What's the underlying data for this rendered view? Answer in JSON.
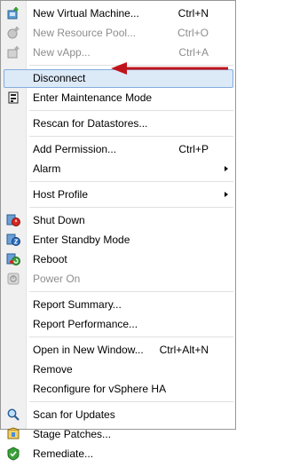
{
  "menu": {
    "new_vm": {
      "label": "New Virtual Machine...",
      "shortcut": "Ctrl+N"
    },
    "new_pool": {
      "label": "New Resource Pool...",
      "shortcut": "Ctrl+O"
    },
    "new_vapp": {
      "label": "New vApp...",
      "shortcut": "Ctrl+A"
    },
    "disconnect": {
      "label": "Disconnect"
    },
    "maintenance": {
      "label": "Enter Maintenance Mode"
    },
    "rescan": {
      "label": "Rescan for Datastores..."
    },
    "add_permission": {
      "label": "Add Permission...",
      "shortcut": "Ctrl+P"
    },
    "alarm": {
      "label": "Alarm"
    },
    "host_profile": {
      "label": "Host Profile"
    },
    "shut_down": {
      "label": "Shut Down"
    },
    "standby": {
      "label": "Enter Standby Mode"
    },
    "reboot": {
      "label": "Reboot"
    },
    "power_on": {
      "label": "Power On"
    },
    "report_summary": {
      "label": "Report Summary..."
    },
    "report_performance": {
      "label": "Report Performance..."
    },
    "open_new_window": {
      "label": "Open in New Window...",
      "shortcut": "Ctrl+Alt+N"
    },
    "remove": {
      "label": "Remove"
    },
    "reconfigure_ha": {
      "label": "Reconfigure for vSphere HA"
    },
    "scan_updates": {
      "label": "Scan for Updates"
    },
    "stage_patches": {
      "label": "Stage Patches..."
    },
    "remediate": {
      "label": "Remediate..."
    }
  },
  "colors": {
    "highlight_bg": "#dce9f7",
    "highlight_border": "#84acdd",
    "annotation_arrow": "#c0141c",
    "disabled_text": "#8d8d8d"
  }
}
